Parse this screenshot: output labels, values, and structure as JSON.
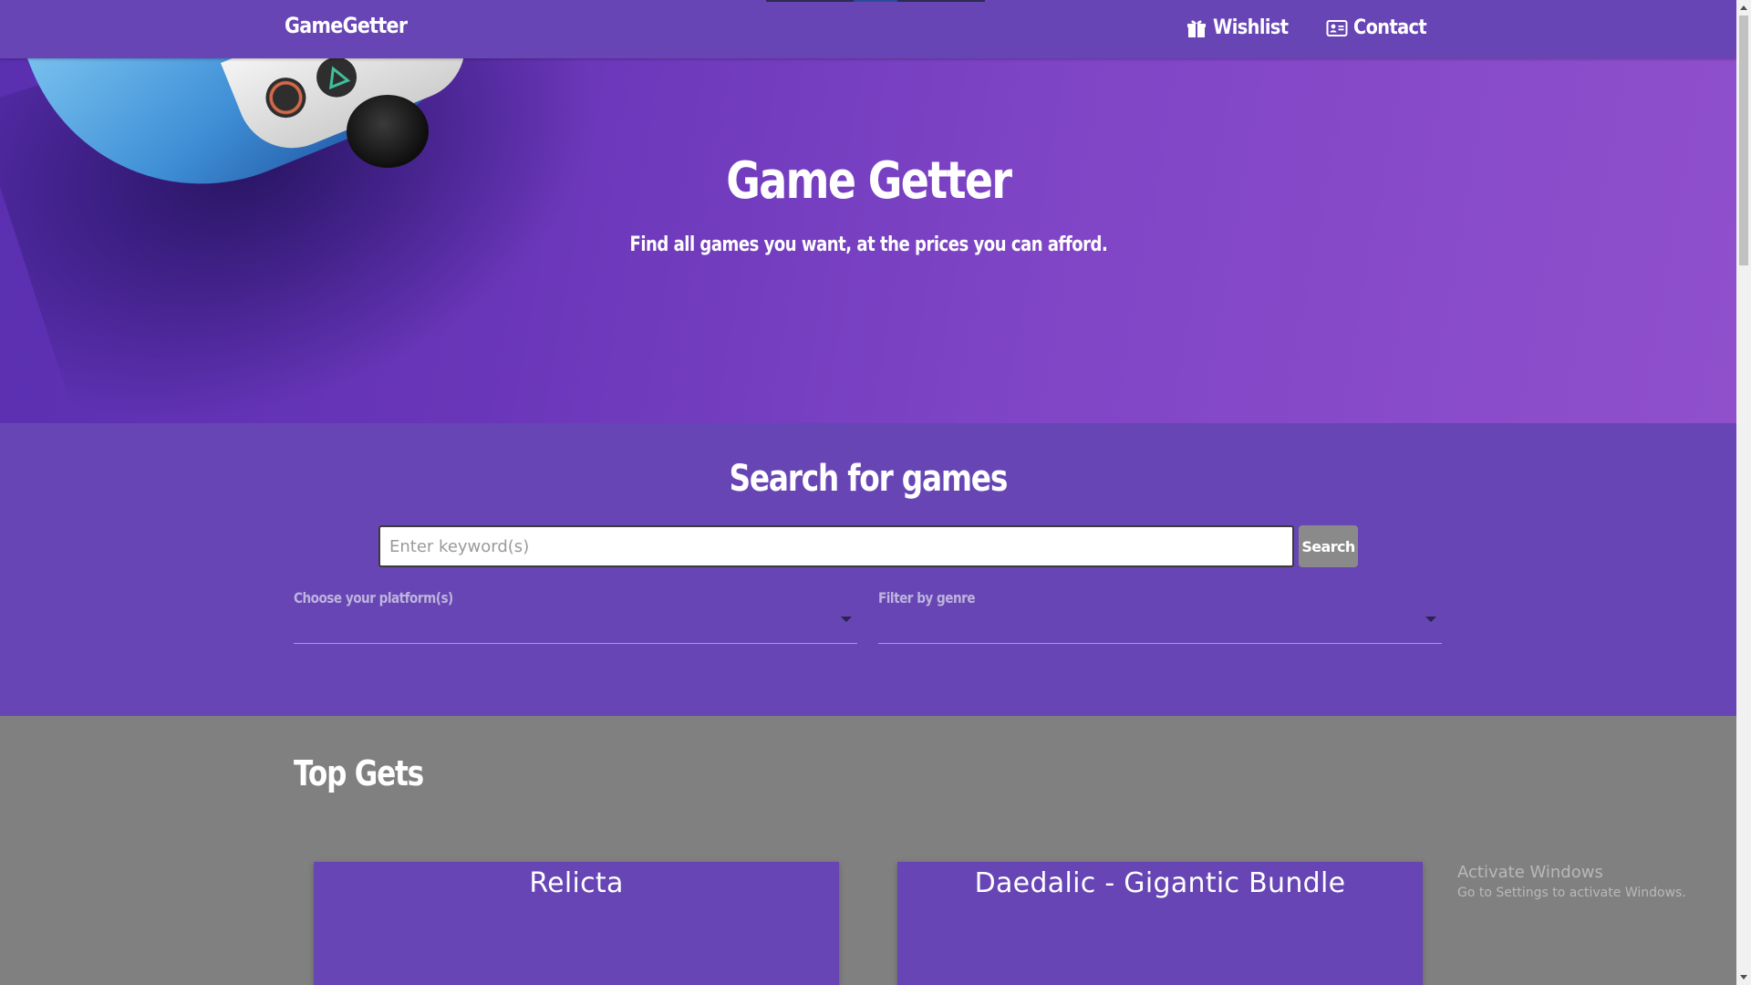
{
  "nav": {
    "brand": "GameGetter",
    "links": [
      {
        "label": "Wishlist",
        "icon": "gift-icon"
      },
      {
        "label": "Contact",
        "icon": "contact-card-icon"
      }
    ]
  },
  "hero": {
    "title": "Game Getter",
    "subtitle": "Find all games you want, at the prices you can afford."
  },
  "search": {
    "title": "Search for games",
    "placeholder": "Enter keyword(s)",
    "button_label": "Search",
    "platform_label": "Choose your platform(s)",
    "genre_label": "Filter by genre"
  },
  "top_gets": {
    "title": "Top Gets",
    "cards": [
      {
        "title": "Relicta"
      },
      {
        "title": "Daedalic - Gigantic Bundle"
      }
    ]
  },
  "watermark": {
    "line1": "Activate Windows",
    "line2": "Go to Settings to activate Windows."
  },
  "colors": {
    "primary": "#6745b4",
    "hero_gradient_end": "#9050cc",
    "page_background": "#808080",
    "search_button": "#8a8a8a"
  }
}
